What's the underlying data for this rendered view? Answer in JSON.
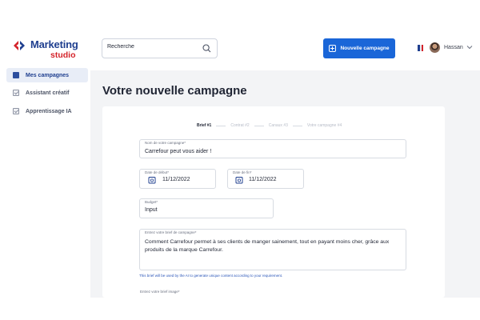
{
  "brand": {
    "title": "Marketing",
    "subtitle": "studio"
  },
  "sidebar": {
    "items": [
      {
        "label": "Mes campagnes",
        "active": true
      },
      {
        "label": "Assistant créatif",
        "active": false
      },
      {
        "label": "Apprentissage IA",
        "active": false
      }
    ]
  },
  "header": {
    "search_placeholder": "Recherche",
    "new_campaign_label": "Nouvelle campagne",
    "user_name": "Hassan"
  },
  "page": {
    "title": "Votre nouvelle campagne"
  },
  "stepper": {
    "steps": [
      {
        "label": "Brief #1",
        "active": true
      },
      {
        "label": "Contrat #2",
        "active": false
      },
      {
        "label": "Canaux #3",
        "active": false
      },
      {
        "label": "Votre campagne #4",
        "active": false
      }
    ]
  },
  "form": {
    "campaign_name": {
      "label": "Nom de votre campagne*",
      "value": "Carrefour peut vous aider !"
    },
    "start_date": {
      "label": "Date de début*",
      "value": "11/12/2022"
    },
    "end_date": {
      "label": "Date de fin*",
      "value": "11/12/2022"
    },
    "budget": {
      "label": "Budget*",
      "value": "Input"
    },
    "brief": {
      "label": "Entrez votre brief de campagne*",
      "value": "Comment Carrefour permet à ses clients de manger sainement, tout en payant moins cher, grâce aux produits de la marque Carrefour.",
      "hint": "This brief will be used by the AI to generate unique content according to your requirement."
    },
    "image_brief": {
      "label": "Entrez votre brief image*"
    }
  },
  "colors": {
    "primary": "#1a66d8",
    "brand_blue": "#1f3f8f",
    "brand_red": "#d4232a"
  }
}
